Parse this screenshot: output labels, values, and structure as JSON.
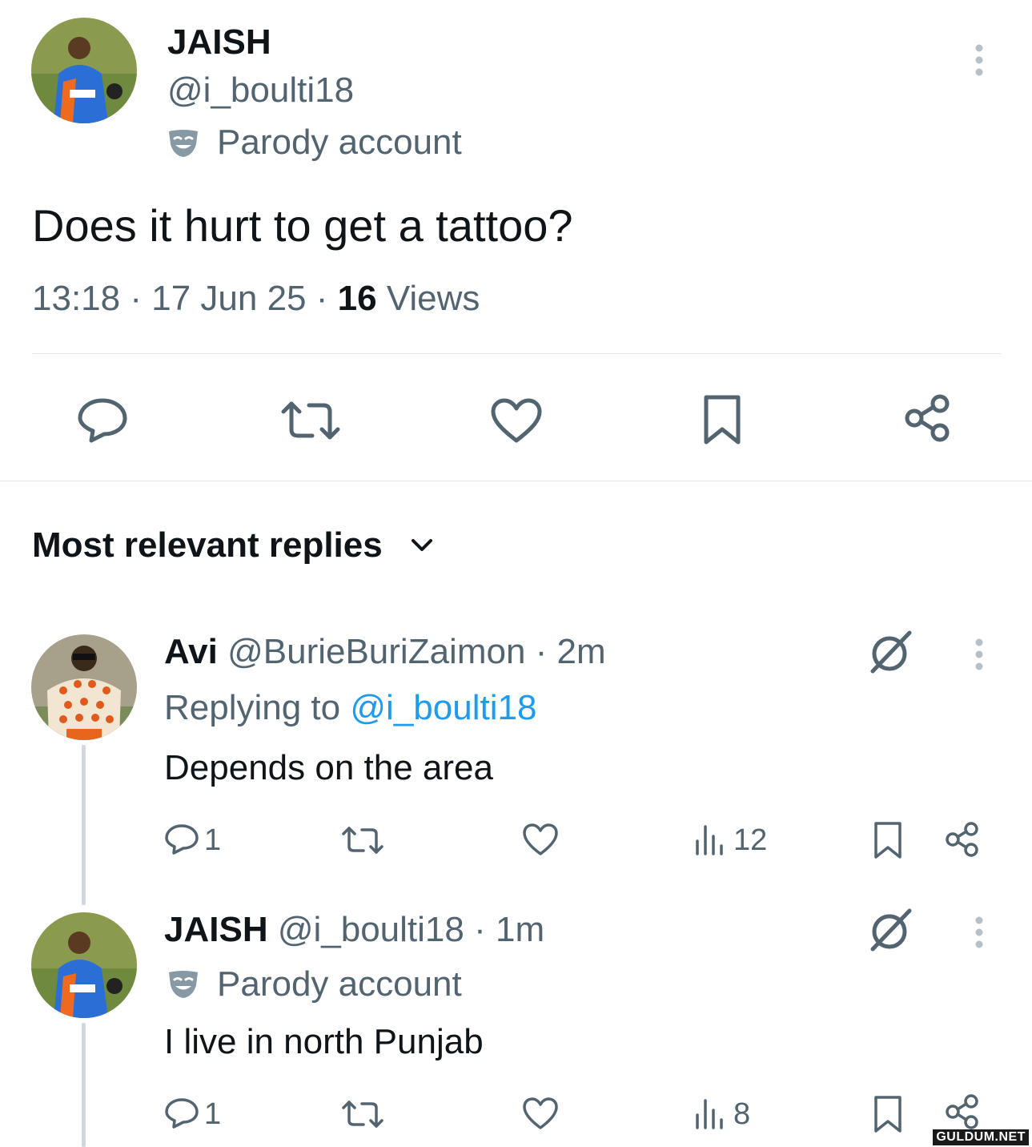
{
  "post": {
    "display_name": "JAISH",
    "handle": "@i_boulti18",
    "parody_label": "Parody account",
    "text": "Does it hurt to get a tattoo?",
    "time": "13:18",
    "date": "17 Jun 25",
    "views_count": "16",
    "views_label": "Views"
  },
  "replies_header": {
    "label": "Most relevant replies"
  },
  "replies": [
    {
      "display_name": "Avi",
      "handle": "@BurieBuriZaimon",
      "age": "· 2m",
      "replying_prefix": "Replying to",
      "replying_handle": "@i_boulti18",
      "text": "Depends on the area",
      "reply_count": "1",
      "views": "12"
    },
    {
      "display_name": "JAISH",
      "handle": "@i_boulti18",
      "age": "· 1m",
      "parody_label": "Parody account",
      "text": "I live in north Punjab",
      "reply_count": "1",
      "views": "8"
    }
  ],
  "watermark": "GULDUM.NET",
  "colors": {
    "text": "#0f1419",
    "muted": "#536471",
    "link": "#1d9bf0",
    "divider": "#e1e8ed"
  },
  "icons": [
    "more-vertical-icon",
    "parody-mask-icon",
    "reply-icon",
    "repost-icon",
    "like-icon",
    "bookmark-icon",
    "share-icon",
    "chevron-down-icon",
    "grok-icon",
    "views-icon"
  ]
}
